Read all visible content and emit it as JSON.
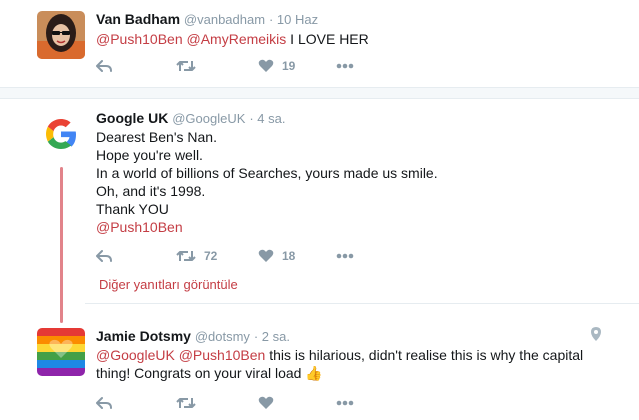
{
  "tweets": [
    {
      "name": "Van Badham",
      "handle": "@vanbadham",
      "time": "· 10 Haz",
      "mention1": "@Push10Ben",
      "mention2": "@AmyRemeikis",
      "text": "I LOVE HER",
      "likes": "19",
      "retweets": ""
    },
    {
      "name": "Google UK",
      "handle": "@GoogleUK",
      "time": "· 4 sa.",
      "lines": [
        "Dearest Ben's Nan.",
        "Hope you're well.",
        "In a world of billions of Searches, yours made us smile.",
        "Oh, and it's 1998.",
        "Thank YOU"
      ],
      "mention": "@Push10Ben",
      "retweets": "72",
      "likes": "18"
    },
    {
      "name": "Jamie Dotsmy",
      "handle": "@dotsmy",
      "time": "· 2 sa.",
      "mention1": "@GoogleUK",
      "mention2": "@Push10Ben",
      "text1": "this is hilarious, didn't realise this is why the capital",
      "text2": "thing! Congrats on your viral load",
      "emoji": "👍"
    }
  ],
  "more_replies": "Diğer yanıtları görüntüle",
  "icons": {
    "reply": "reply-icon",
    "retweet": "retweet-icon",
    "like": "heart-icon",
    "more": "more-icon",
    "location": "location-pin-icon",
    "google": "google-g-logo"
  },
  "colors": {
    "link": "#c43d44",
    "thread_line": "#e2838a",
    "action_gray": "#8899a6"
  }
}
